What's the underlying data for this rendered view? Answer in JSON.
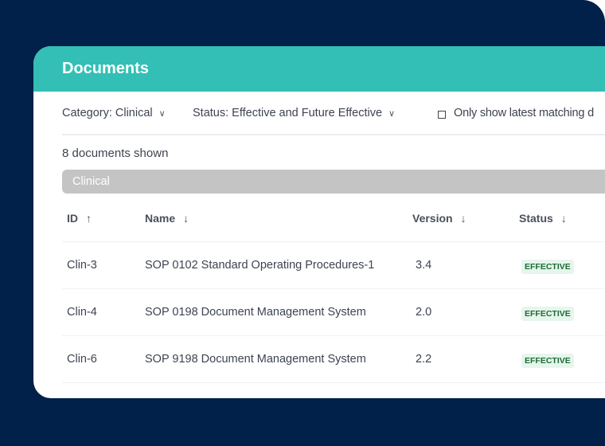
{
  "colors": {
    "background": "#01204a",
    "header": "#33bfb5",
    "group_bar": "#c4c4c4",
    "badge_bg": "#e6f6ec",
    "badge_text": "#1b6b35"
  },
  "header": {
    "title": "Documents"
  },
  "filters": {
    "category": "Category: Clinical",
    "status": "Status: Effective and Future Effective",
    "latest_checkbox_label": "Only show latest matching d",
    "latest_checked": false
  },
  "count_text": "8 documents shown",
  "group": {
    "label": "Clinical"
  },
  "table": {
    "columns": [
      {
        "label": "ID",
        "sort": "↑"
      },
      {
        "label": "Name",
        "sort": "↓"
      },
      {
        "label": "Version",
        "sort": "↓"
      },
      {
        "label": "Status",
        "sort": "↓"
      }
    ],
    "rows": [
      {
        "id": "Clin-3",
        "name": "SOP 0102 Standard Operating Procedures-1",
        "version": "3.4",
        "status": "EFFECTIVE"
      },
      {
        "id": "Clin-4",
        "name": "SOP 0198 Document Management System",
        "version": "2.0",
        "status": "EFFECTIVE"
      },
      {
        "id": "Clin-6",
        "name": "SOP 9198 Document Management System",
        "version": "2.2",
        "status": "EFFECTIVE"
      }
    ]
  }
}
